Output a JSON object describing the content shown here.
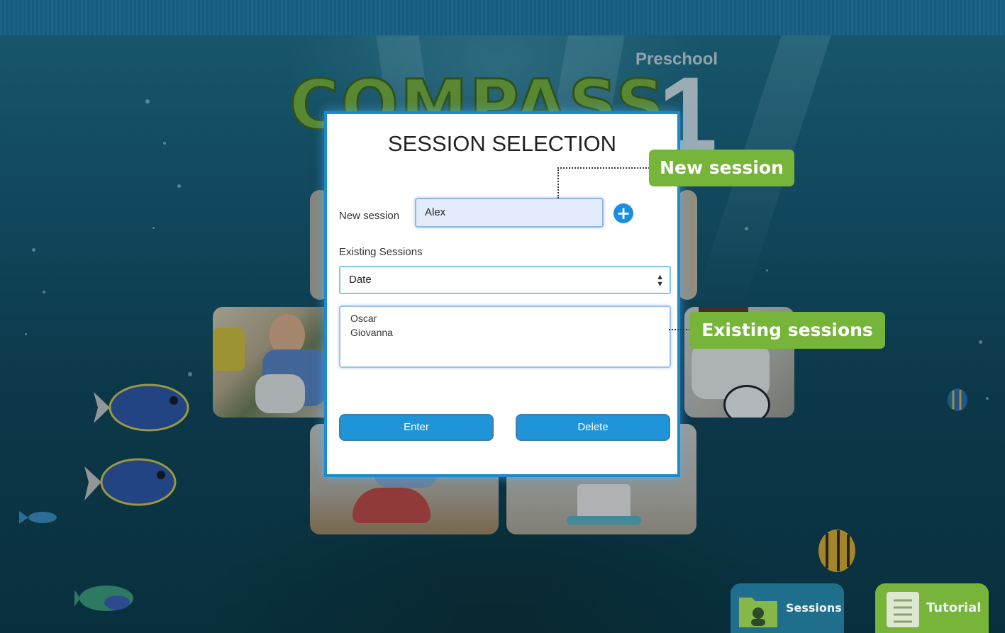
{
  "app": {
    "logo": "COMPASS",
    "level_label": "Preschool",
    "level_number": "1"
  },
  "modal": {
    "title": "SESSION SELECTION",
    "new_session_label": "New session",
    "new_session_value": "Alex",
    "add_icon": "plus-circle-icon",
    "existing_label": "Existing Sessions",
    "sort_select": {
      "selected": "Date"
    },
    "sessions": [
      "Oscar",
      "Giovanna"
    ],
    "enter_label": "Enter",
    "delete_label": "Delete"
  },
  "callouts": {
    "new_session": "New session",
    "existing_sessions": "Existing sessions"
  },
  "bottom_nav": {
    "sessions_label": "Sessions",
    "tutorial_label": "Tutorial"
  },
  "colors": {
    "accent_blue": "#1f94d8",
    "callout_green": "#77b43a",
    "modal_border": "#1b8bd0"
  }
}
